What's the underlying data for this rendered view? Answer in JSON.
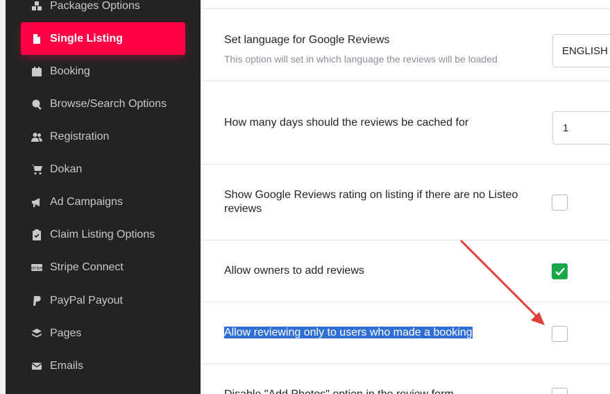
{
  "sidebar": {
    "items": [
      {
        "label": "Packages Options",
        "icon": "boxes-icon"
      },
      {
        "label": "Single Listing",
        "icon": "file-icon",
        "active": true
      },
      {
        "label": "Booking",
        "icon": "calendar-icon"
      },
      {
        "label": "Browse/Search Options",
        "icon": "search-location-icon"
      },
      {
        "label": "Registration",
        "icon": "users-icon"
      },
      {
        "label": "Dokan",
        "icon": "cart-icon"
      },
      {
        "label": "Ad Campaigns",
        "icon": "megaphone-icon"
      },
      {
        "label": "Claim Listing Options",
        "icon": "clipboard-check-icon"
      },
      {
        "label": "Stripe Connect",
        "icon": "stripe-icon"
      },
      {
        "label": "PayPal Payout",
        "icon": "paypal-icon"
      },
      {
        "label": "Pages",
        "icon": "layers-icon"
      },
      {
        "label": "Emails",
        "icon": "envelope-icon"
      }
    ]
  },
  "settings": {
    "language": {
      "title": "Set language for Google Reviews",
      "description": "This option will set in which language the reviews will be loaded",
      "value": "ENGLISH"
    },
    "cache_days": {
      "title": "How many days should the reviews be cached for",
      "value": "1"
    },
    "show_google_rating": {
      "title": "Show Google Reviews rating on listing if there are no Listeo reviews",
      "checked": false
    },
    "owners_add_reviews": {
      "title": "Allow owners to add reviews",
      "checked": true
    },
    "booking_only_reviews": {
      "title": "Allow reviewing only to users who made a booking",
      "checked": false,
      "highlighted": true
    },
    "disable_add_photos": {
      "title": "Disable \"Add Photos\" option in the review form",
      "checked": false
    }
  },
  "colors": {
    "active_item": "#ff0044",
    "sidebar_bg": "#232323",
    "checked_green": "#1aa64a",
    "arrow": "#e0403a",
    "selection": "#2f6fd4"
  }
}
